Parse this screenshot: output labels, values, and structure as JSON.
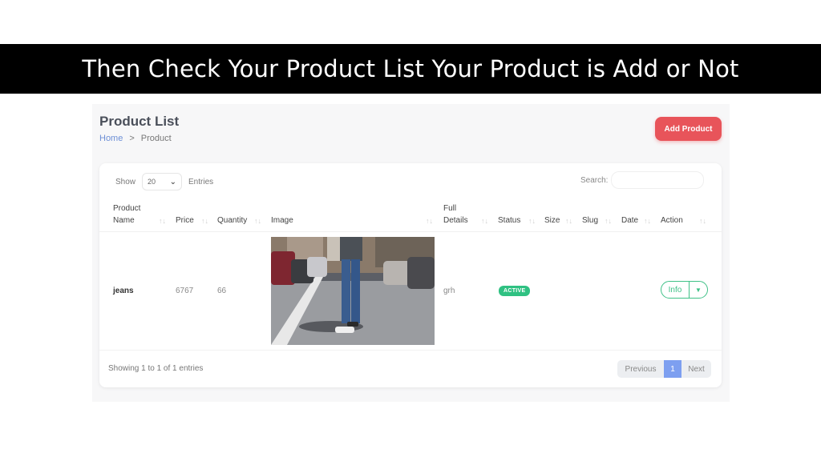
{
  "banner": {
    "title": "Then Check Your Product List Your Product is Add or Not"
  },
  "page": {
    "title": "Product List",
    "breadcrumb": {
      "home": "Home",
      "separator": ">",
      "current": "Product"
    },
    "add_button": "Add Product"
  },
  "table_controls": {
    "show_label": "Show",
    "page_size": "20",
    "entries_label": "Entries",
    "search_label": "Search:",
    "search_value": ""
  },
  "columns": {
    "product_name_line1": "Product",
    "product_name_line2": "Name",
    "price": "Price",
    "quantity": "Quantity",
    "image": "Image",
    "full_details_line1": "Full",
    "full_details_line2": "Details",
    "status": "Status",
    "size": "Size",
    "slug": "Slug",
    "date": "Date",
    "action": "Action"
  },
  "rows": [
    {
      "name": "jeans",
      "price": "6767",
      "quantity": "66",
      "full_details": "grh",
      "status": "ACTIVE",
      "size": "",
      "slug": "",
      "date": "",
      "action_label": "Info"
    }
  ],
  "footer": {
    "summary": "Showing 1 to 1 of 1 entries",
    "previous": "Previous",
    "page": "1",
    "next": "Next"
  },
  "colors": {
    "accent_red": "#e8545a",
    "status_green": "#2fc182",
    "pager_active": "#7d9ff0"
  },
  "icons": [
    "chevron-down-icon",
    "sort-arrows-icon",
    "caret-down-icon",
    "breadcrumb-chevron-icon"
  ]
}
